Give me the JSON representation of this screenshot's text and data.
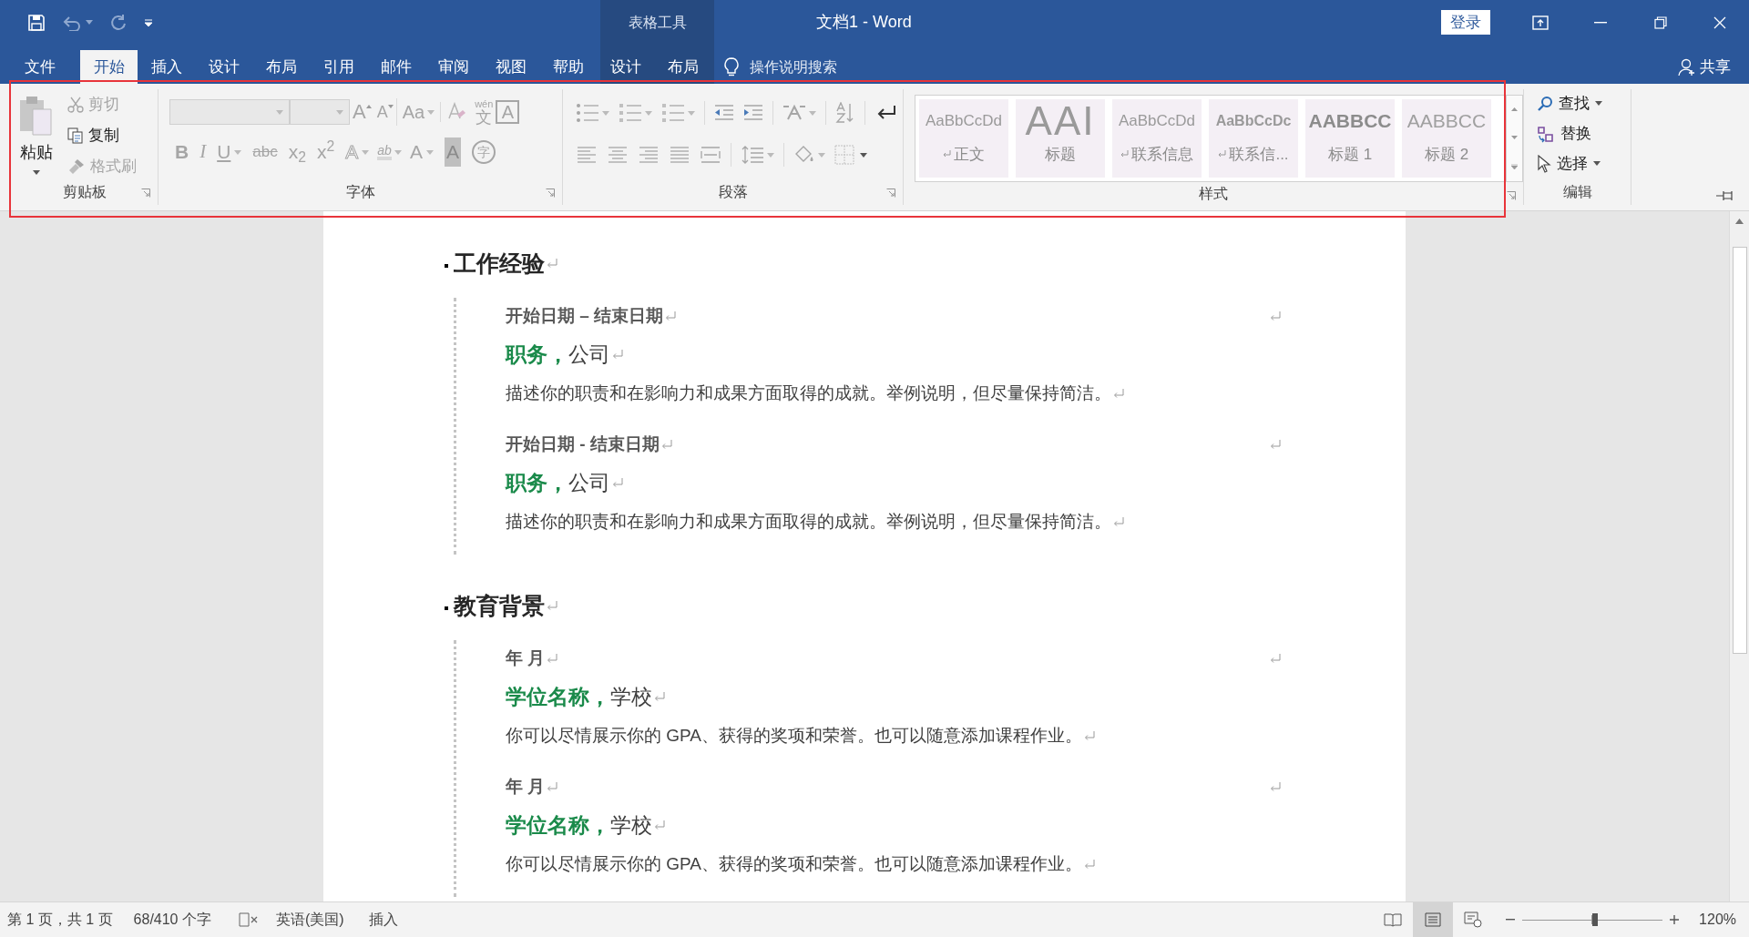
{
  "window": {
    "title": "文档1  -  Word",
    "contextual_label": "表格工具",
    "sign_in": "登录"
  },
  "tabs": [
    {
      "label": "文件",
      "selected": false,
      "kind": "file"
    },
    {
      "label": "开始",
      "selected": true,
      "kind": "normal"
    },
    {
      "label": "插入",
      "selected": false,
      "kind": "normal"
    },
    {
      "label": "设计",
      "selected": false,
      "kind": "normal"
    },
    {
      "label": "布局",
      "selected": false,
      "kind": "normal"
    },
    {
      "label": "引用",
      "selected": false,
      "kind": "normal"
    },
    {
      "label": "邮件",
      "selected": false,
      "kind": "normal"
    },
    {
      "label": "审阅",
      "selected": false,
      "kind": "normal"
    },
    {
      "label": "视图",
      "selected": false,
      "kind": "normal"
    },
    {
      "label": "帮助",
      "selected": false,
      "kind": "normal"
    },
    {
      "label": "设计",
      "selected": false,
      "kind": "contextual"
    },
    {
      "label": "布局",
      "selected": false,
      "kind": "contextual"
    }
  ],
  "search": {
    "placeholder": "操作说明搜索"
  },
  "share": "共享",
  "clipboard": {
    "label": "剪贴板",
    "paste": "粘贴",
    "items": [
      {
        "kind": "cut",
        "label": "剪切",
        "disabled": true
      },
      {
        "kind": "copy",
        "label": "复制",
        "disabled": false
      },
      {
        "kind": "painter",
        "label": "格式刷",
        "disabled": true
      }
    ]
  },
  "font": {
    "label": "字体",
    "row1": [
      {
        "kind": "font-name"
      },
      {
        "kind": "font-size"
      },
      {
        "kind": "grow",
        "text": "A"
      },
      {
        "kind": "shrink",
        "text": "A"
      },
      {
        "kind": "case",
        "text": "Aa"
      },
      {
        "kind": "clear"
      },
      {
        "kind": "phonetic",
        "text": "wén",
        "sub": "文"
      },
      {
        "kind": "boxed",
        "text": "A"
      }
    ],
    "row2": [
      {
        "kind": "bold",
        "text": "B"
      },
      {
        "kind": "italic",
        "text": "I"
      },
      {
        "kind": "underline",
        "text": "U",
        "caret": true
      },
      {
        "kind": "strike",
        "text": "abc"
      },
      {
        "kind": "subscript",
        "text": "x$_{2}$"
      },
      {
        "kind": "superscript",
        "text": "x$^{2}$"
      },
      {
        "kind": "effects",
        "text": "A",
        "caret": true
      },
      {
        "kind": "highlight",
        "text": "ab",
        "caret": true
      },
      {
        "kind": "color",
        "text": "A",
        "caret": true
      },
      {
        "kind": "shading",
        "text": "A"
      },
      {
        "kind": "enclose",
        "text": "字"
      }
    ]
  },
  "paragraph": {
    "label": "段落"
  },
  "styles": {
    "label": "样式",
    "items": [
      {
        "kind": "normal",
        "preview": "AaBbCcDd",
        "name": "正文",
        "mark": true
      },
      {
        "kind": "title",
        "preview": "AAI",
        "name": "标题",
        "mark": false
      },
      {
        "kind": "normal",
        "preview": "AaBbCcDd",
        "name": "联系信息",
        "mark": true
      },
      {
        "kind": "bold",
        "preview": "AaBbCcDc",
        "name": "联系信...",
        "mark": true
      },
      {
        "kind": "heading1",
        "preview": "AABBCC",
        "name": "标题 1",
        "mark": false
      },
      {
        "kind": "heading2",
        "preview": "AABBCC",
        "name": "标题 2",
        "mark": false
      }
    ]
  },
  "editing": {
    "label": "编辑",
    "items": [
      {
        "kind": "find",
        "label": "查找",
        "caret": true
      },
      {
        "kind": "replace",
        "label": "替换",
        "caret": false
      },
      {
        "kind": "select",
        "label": "选择",
        "caret": true
      }
    ]
  },
  "document": {
    "sections": [
      {
        "heading": "工作经验",
        "entries": [
          {
            "date": "开始日期 – 结束日期",
            "title": "**职务，**公司",
            "description": "描述你的职责和在影响力和成果方面取得的成就。举例说明，但尽量保持简洁。"
          },
          {
            "date": "开始日期 - 结束日期",
            "title": "**职务，**公司",
            "description": "描述你的职责和在影响力和成果方面取得的成就。举例说明，但尽量保持简洁。"
          }
        ]
      },
      {
        "heading": "教育背景",
        "entries": [
          {
            "date": "年 月",
            "title": "**学位名称，**学校",
            "description": "你可以尽情展示你的 GPA、获得的奖项和荣誉。也可以随意添加课程作业。"
          },
          {
            "date": "年 月",
            "title": "**学位名称，**学校",
            "description": "你可以尽情展示你的 GPA、获得的奖项和荣誉。也可以随意添加课程作业。"
          }
        ]
      }
    ]
  },
  "status_bar": {
    "page": "第 1 页，共 1 页",
    "words": "68/410 个字",
    "language": "英语(美国)",
    "mode": "插入",
    "views": [
      {
        "kind": "read",
        "selected": false
      },
      {
        "kind": "print",
        "selected": true
      },
      {
        "kind": "web",
        "selected": false
      }
    ],
    "zoom": {
      "level": 0.52,
      "reading": "120%"
    }
  }
}
